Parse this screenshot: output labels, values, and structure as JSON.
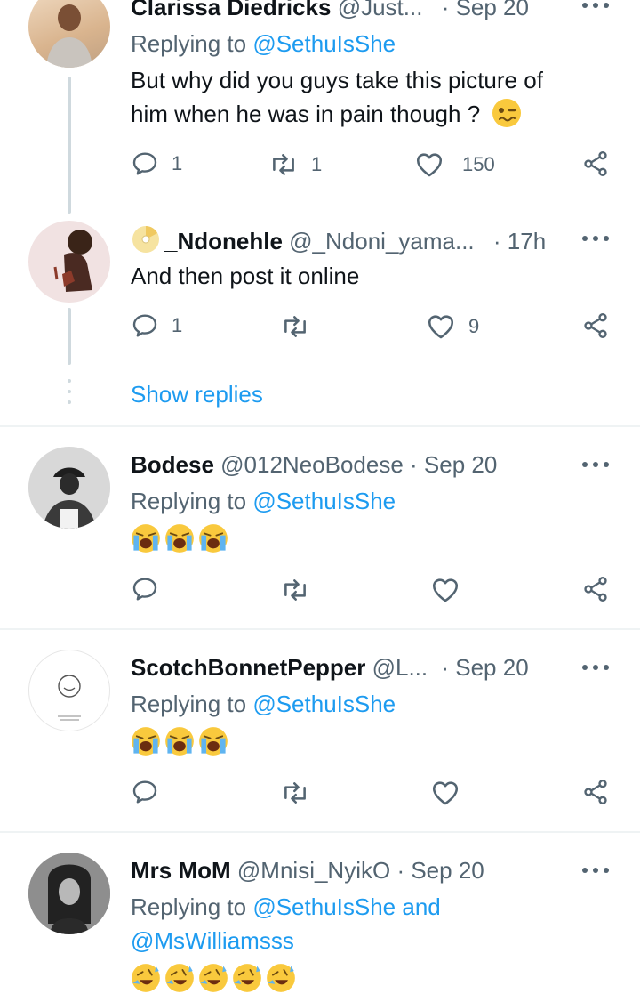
{
  "tweets": [
    {
      "name": "Clarissa Diedricks",
      "handle": "@Just...",
      "time": "· Sep 20",
      "replying_prefix": "Replying to ",
      "replying_to": "@SethuIsShe",
      "text_line1": "But why did you guys take this picture of",
      "text_line2": "him when he was in pain though ?",
      "replies": "1",
      "retweets": "1",
      "likes": "150"
    },
    {
      "name": "_Ndonehle",
      "handle": "@_Ndoni_yama...",
      "time": "· 17h",
      "text": "And then post it online",
      "replies": "1",
      "retweets": "",
      "likes": "9"
    },
    {
      "name": "Bodese",
      "handle": "@012NeoBodese",
      "time": "· Sep 20",
      "replying_prefix": "Replying to ",
      "replying_to": "@SethuIsShe"
    },
    {
      "name": "ScotchBonnetPepper",
      "handle": "@L...",
      "time": "· Sep 20",
      "replying_prefix": "Replying to ",
      "replying_to": "@SethuIsShe"
    },
    {
      "name": "Mrs MoM",
      "handle": "@Mnisi_NyikO",
      "time": "· Sep 20",
      "replying_prefix": "Replying to ",
      "replying_to": "@SethuIsShe",
      "replying_and": " and",
      "replying_to2": "@MsWilliamsss"
    }
  ],
  "show_replies": "Show replies",
  "icons": {
    "reply": "reply-icon",
    "retweet": "retweet-icon",
    "like": "heart-icon",
    "share": "share-icon",
    "more": "more-icon",
    "emoji_woozy": "woozy-face-emoji",
    "emoji_crying": "loudly-crying-emoji",
    "emoji_rofl": "rolling-laughing-emoji"
  },
  "colors": {
    "link": "#1d9bf0",
    "secondary_text": "#536471",
    "divider": "#eff3f4"
  }
}
